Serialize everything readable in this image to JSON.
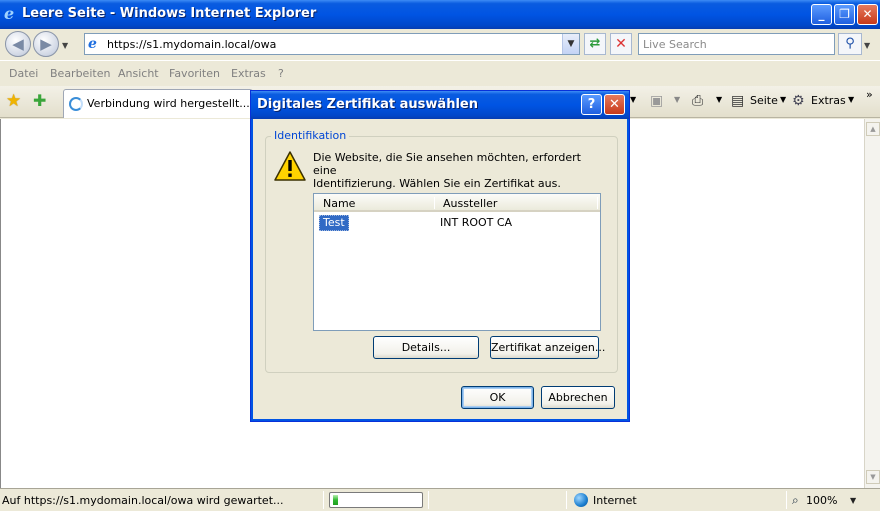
{
  "window": {
    "title": "Leere Seite - Windows Internet Explorer",
    "minimize": "_",
    "maximize": "❐",
    "close": "✕"
  },
  "navbar": {
    "url": "https://s1.mydomain.local/owa",
    "search_placeholder": "Live Search"
  },
  "menu": {
    "items": [
      "Datei",
      "Bearbeiten",
      "Ansicht",
      "Favoriten",
      "Extras",
      "?"
    ]
  },
  "tabbar": {
    "tab_label": "Verbindung wird hergestellt...",
    "page_label": "Seite",
    "tools_label": "Extras"
  },
  "statusbar": {
    "text": "Auf https://s1.mydomain.local/owa wird gewartet...",
    "progress": 0.06,
    "zone": "Internet",
    "zoom": "100%"
  },
  "dialog": {
    "title": "Digitales Zertifikat auswählen",
    "help": "?",
    "group_label": "Identifikation",
    "message_line1": "Die Website, die Sie ansehen möchten, erfordert eine",
    "message_line2": "Identifizierung. Wählen Sie ein Zertifikat aus.",
    "columns": {
      "name": "Name",
      "issuer": "Aussteller"
    },
    "rows": [
      {
        "name": "Test",
        "issuer": "INT ROOT CA"
      }
    ],
    "details_button": "Details...",
    "view_cert_button": "Zertifikat anzeigen...",
    "ok_button": "OK",
    "cancel_button": "Abbrechen"
  }
}
